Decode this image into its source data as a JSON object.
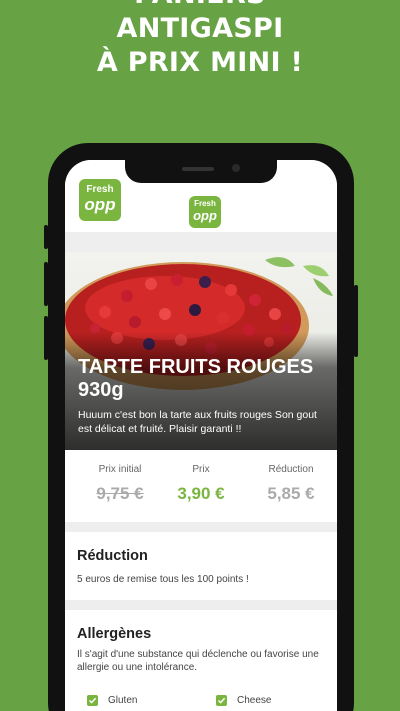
{
  "headline": {
    "line1": "PANIERS",
    "line2": "ANTIGASPI",
    "line3": "À PRIX MINI !"
  },
  "brand": {
    "logo_top": "Fresh",
    "logo_bottom": "opp"
  },
  "colors": {
    "background": "#67a345",
    "accent": "#7ab540"
  },
  "product": {
    "title": "TARTE FRUITS ROUGES 930g",
    "description": "Huuum c'est bon la tarte aux fruits rouges Son gout est délicat et fruité. Plaisir garanti !!"
  },
  "prices": {
    "initial_label": "Prix initial",
    "initial_value": "9,75 €",
    "price_label": "Prix",
    "price_value": "3,90 €",
    "reduction_label": "Réduction",
    "reduction_value": "5,85 €"
  },
  "reduction_section": {
    "title": "Réduction",
    "text": "5 euros de remise tous les 100 points !"
  },
  "allergens_section": {
    "title": "Allergènes",
    "text": "Il s'agit d'une substance qui déclenche ou favorise une allergie ou une intolérance.",
    "items": [
      {
        "label": "Gluten",
        "checked": true
      },
      {
        "label": "Cheese",
        "checked": true
      }
    ]
  },
  "icons": [
    "checkbox-checked-icon"
  ]
}
